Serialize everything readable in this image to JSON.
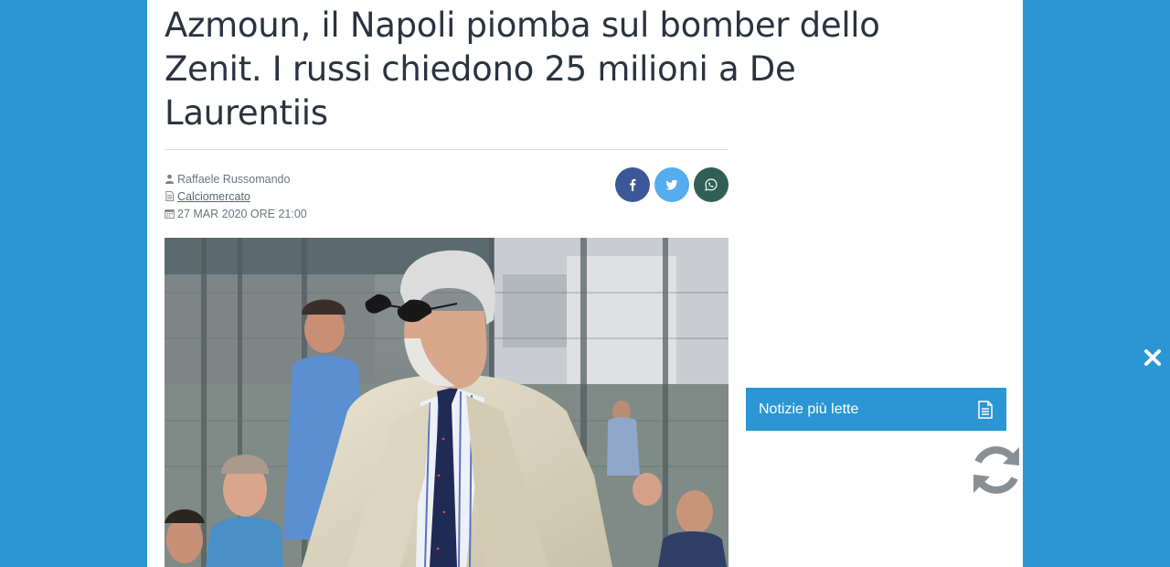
{
  "article": {
    "title": "Azmoun, il Napoli piomba sul bomber dello Zenit. I russi chiedono 25 milioni a De Laurentiis",
    "author": "Raffaele Russomando",
    "category": "Calciomercato",
    "date": "27 MAR 2020 ORE 21:00"
  },
  "share": {
    "facebook_icon": "f",
    "twitter_icon": "twitter-bird-icon",
    "whatsapp_icon": "whatsapp-icon"
  },
  "sidebar": {
    "widget_label": "Notizie più lette",
    "widget_icon": "document-icon"
  },
  "icons": {
    "close": "close-icon",
    "reload": "reload-icon"
  },
  "colors": {
    "background": "#2a96d4",
    "title": "#2b3340",
    "facebook": "#3b5998",
    "twitter": "#55acee",
    "whatsapp": "#2f5f55",
    "widget": "#2a96d4"
  }
}
